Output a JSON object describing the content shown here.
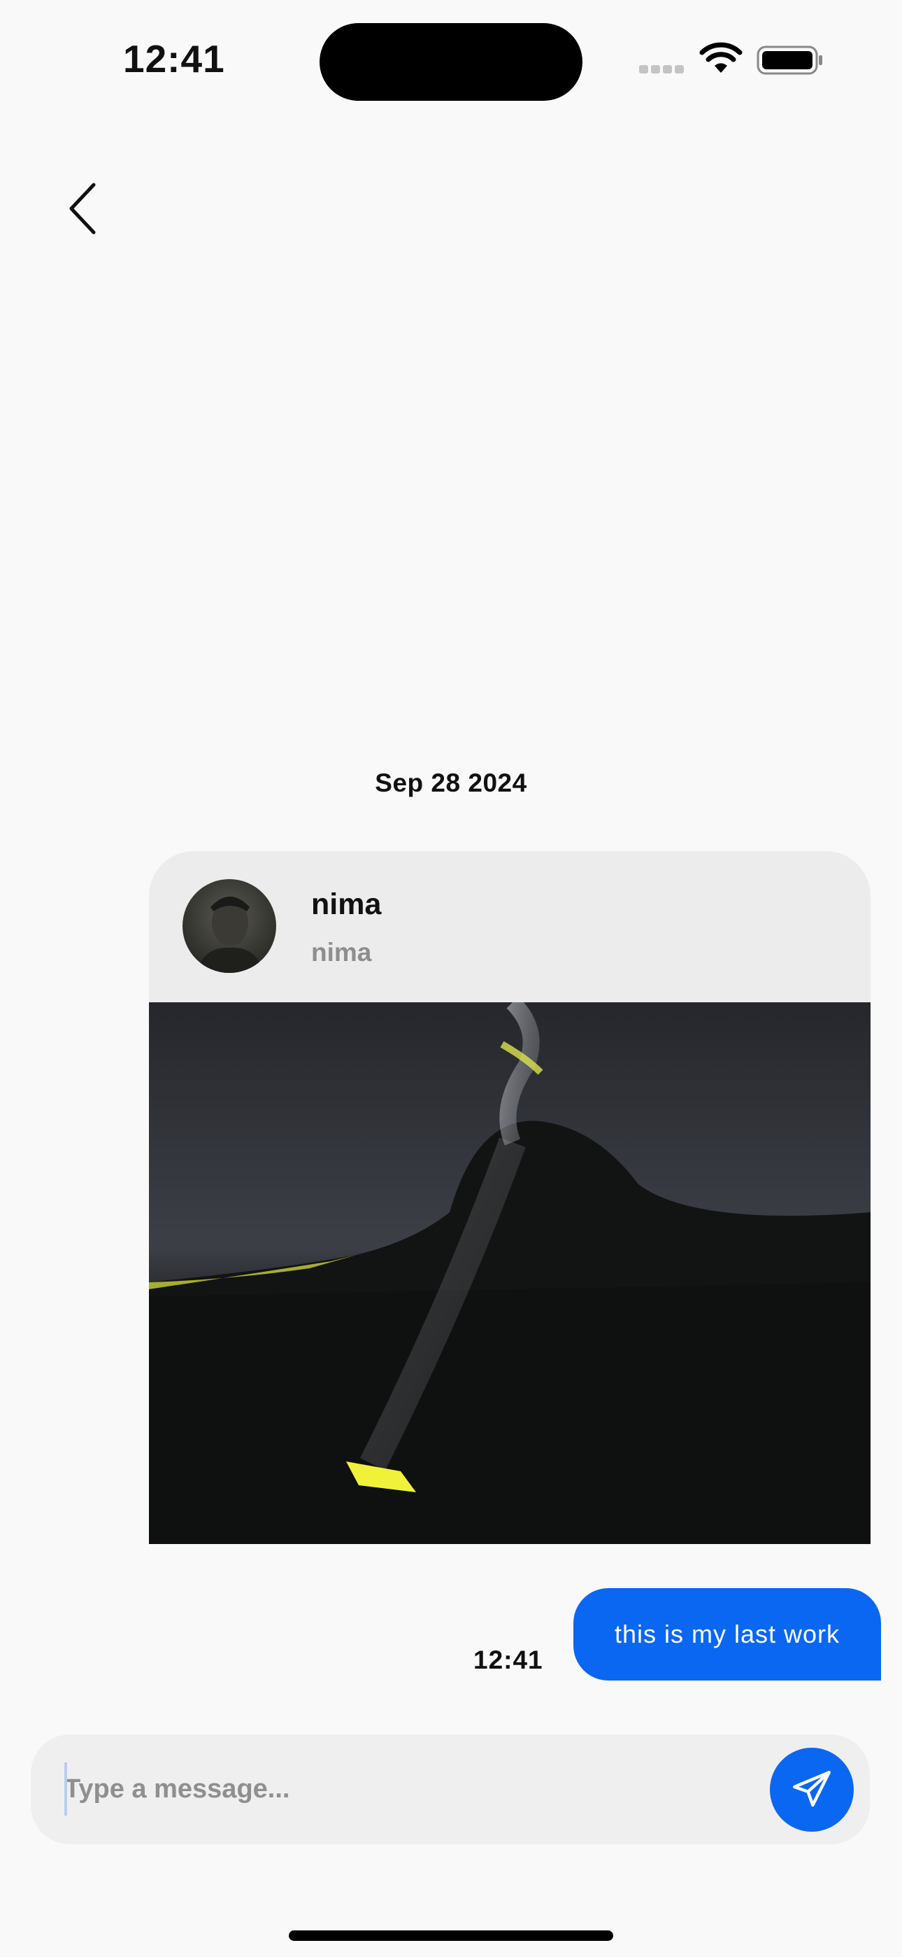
{
  "status_bar": {
    "time": "12:41"
  },
  "nav": {
    "back_icon": "chevron-left-icon"
  },
  "chat": {
    "date_separator": "Sep 28 2024",
    "shared_post": {
      "name": "nima",
      "username": "nima",
      "avatar_icon": "profile-photo",
      "image": "dark night photo with light streak"
    },
    "outgoing_message": {
      "text": "this is my last work",
      "time": "12:41"
    }
  },
  "composer": {
    "placeholder": "Type a message...",
    "value": "",
    "send_icon": "paper-plane-icon"
  },
  "colors": {
    "accent": "#0a67f2",
    "background": "#f9f9f9",
    "card": "#ececec"
  }
}
